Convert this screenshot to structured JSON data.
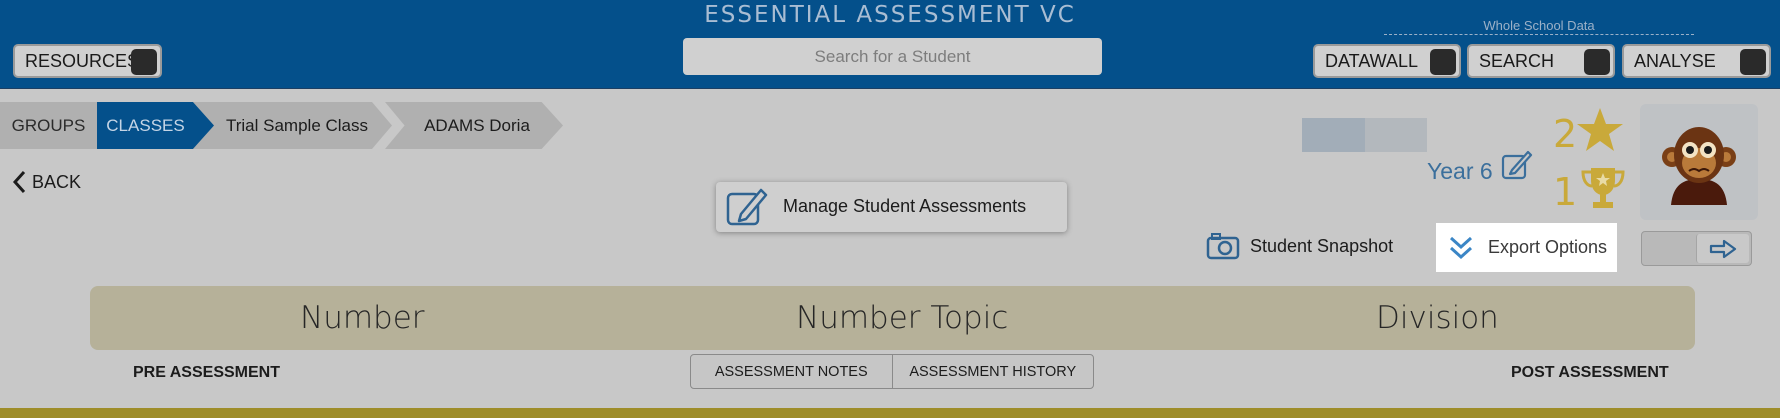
{
  "header": {
    "app_title": "ESSENTIAL ASSESSMENT VC",
    "resources_label": "RESOURCES",
    "search_placeholder": "Search for a Student",
    "whole_school_label": "Whole School Data",
    "datawall_label": "DATAWALL",
    "search_label": "SEARCH",
    "analyse_label": "ANALYSE",
    "brand_color": "#04508b"
  },
  "breadcrumb": {
    "groups": "GROUPS",
    "classes": "CLASSES",
    "class_name": "Trial Sample Class",
    "student_name": "ADAMS Doria"
  },
  "nav": {
    "back_label": "BACK"
  },
  "actions": {
    "manage_label": "Manage Student Assessments",
    "snapshot_label": "Student Snapshot",
    "export_label": "Export Options"
  },
  "student": {
    "year_label": "Year 6",
    "stars": "2",
    "trophies": "1",
    "avatar_icon": "monkey-avatar-icon"
  },
  "topic": {
    "strand": "Number",
    "topic": "Number Topic",
    "subtopic": "Division"
  },
  "assessment": {
    "pre_label": "PRE ASSESSMENT",
    "post_label": "POST ASSESSMENT",
    "notes_tab": "ASSESSMENT NOTES",
    "history_tab": "ASSESSMENT HISTORY"
  }
}
